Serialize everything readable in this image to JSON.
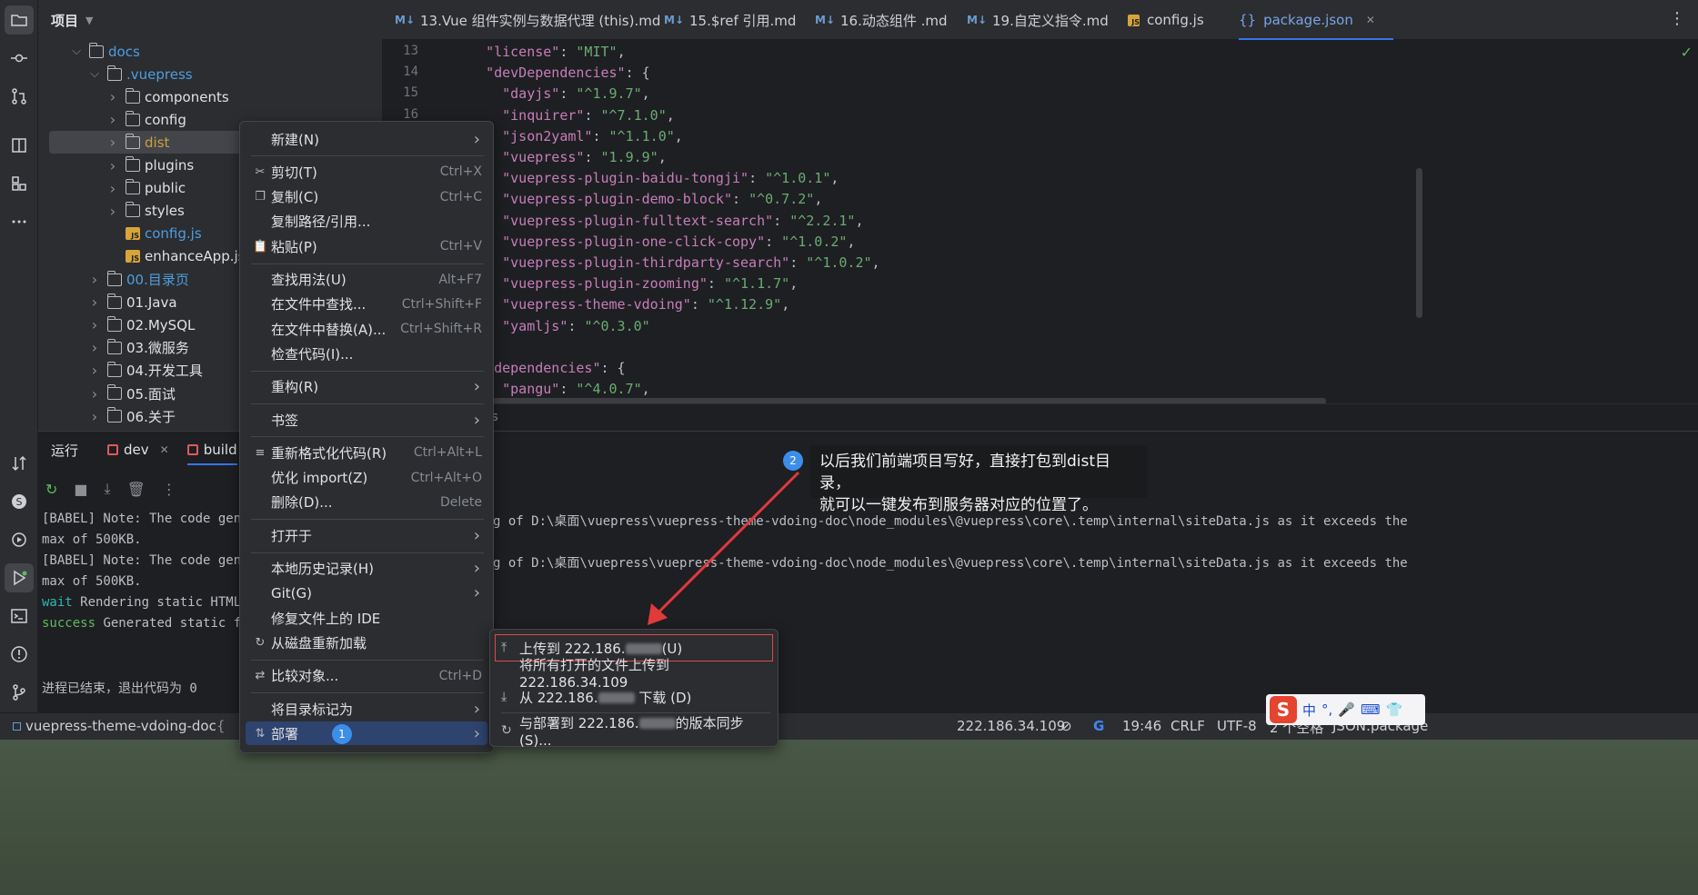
{
  "project": {
    "title": "项目",
    "tree": [
      {
        "label": "docs",
        "type": "folder",
        "depth": 1,
        "open": true,
        "color": "#4f9dde"
      },
      {
        "label": ".vuepress",
        "type": "folder",
        "depth": 2,
        "open": true,
        "color": "#4f9dde"
      },
      {
        "label": "components",
        "type": "folder",
        "depth": 3,
        "open": false,
        "color": "#dfe1e5"
      },
      {
        "label": "config",
        "type": "folder",
        "depth": 3,
        "open": false,
        "color": "#dfe1e5"
      },
      {
        "label": "dist",
        "type": "folder",
        "depth": 3,
        "open": false,
        "color": "#c9a13a",
        "selected": true
      },
      {
        "label": "plugins",
        "type": "folder",
        "depth": 3,
        "open": false,
        "color": "#dfe1e5"
      },
      {
        "label": "public",
        "type": "folder",
        "depth": 3,
        "open": false,
        "color": "#dfe1e5"
      },
      {
        "label": "styles",
        "type": "folder",
        "depth": 3,
        "open": false,
        "color": "#dfe1e5"
      },
      {
        "label": "config.js",
        "type": "js",
        "depth": 3,
        "color": "#4f9dde"
      },
      {
        "label": "enhanceApp.js",
        "type": "js",
        "depth": 3,
        "color": "#dfe1e5"
      },
      {
        "label": "00.目录页",
        "type": "folder",
        "depth": 2,
        "open": false,
        "color": "#4f9dde"
      },
      {
        "label": "01.Java",
        "type": "folder",
        "depth": 2,
        "open": false,
        "color": "#dfe1e5"
      },
      {
        "label": "02.MySQL",
        "type": "folder",
        "depth": 2,
        "open": false,
        "color": "#dfe1e5"
      },
      {
        "label": "03.微服务",
        "type": "folder",
        "depth": 2,
        "open": false,
        "color": "#dfe1e5"
      },
      {
        "label": "04.开发工具",
        "type": "folder",
        "depth": 2,
        "open": false,
        "color": "#dfe1e5"
      },
      {
        "label": "05.面试",
        "type": "folder",
        "depth": 2,
        "open": false,
        "color": "#dfe1e5"
      },
      {
        "label": "06.关于",
        "type": "folder",
        "depth": 2,
        "open": false,
        "color": "#dfe1e5"
      }
    ]
  },
  "tabs": [
    {
      "label": "13.Vue 组件实例与数据代理 (this).md",
      "kind": "md"
    },
    {
      "label": "15.$ref 引用.md",
      "kind": "md"
    },
    {
      "label": "16.动态组件 .md",
      "kind": "md"
    },
    {
      "label": "19.自定义指令.md",
      "kind": "md"
    },
    {
      "label": "config.js",
      "kind": "js"
    },
    {
      "label": "package.json",
      "kind": "json",
      "active": true
    }
  ],
  "editor": {
    "lines": [
      {
        "num": "13",
        "text": "  \"license\": \"MIT\","
      },
      {
        "num": "14",
        "text": "  \"devDependencies\": {"
      },
      {
        "num": "15",
        "text": "    \"dayjs\": \"^1.9.7\","
      },
      {
        "num": "16",
        "text": "    \"inquirer\": \"^7.1.0\","
      },
      {
        "num": "",
        "text": "    \"json2yaml\": \"^1.1.0\","
      },
      {
        "num": "",
        "text": "    \"vuepress\": \"1.9.9\","
      },
      {
        "num": "",
        "text": "    \"vuepress-plugin-baidu-tongji\": \"^1.0.1\","
      },
      {
        "num": "",
        "text": "    \"vuepress-plugin-demo-block\": \"^0.7.2\","
      },
      {
        "num": "",
        "text": "    \"vuepress-plugin-fulltext-search\": \"^2.2.1\","
      },
      {
        "num": "",
        "text": "    \"vuepress-plugin-one-click-copy\": \"^1.0.2\","
      },
      {
        "num": "",
        "text": "    \"vuepress-plugin-thirdparty-search\": \"^1.0.2\","
      },
      {
        "num": "",
        "text": "    \"vuepress-plugin-zooming\": \"^1.1.7\","
      },
      {
        "num": "",
        "text": "    \"vuepress-theme-vdoing\": \"^1.12.9\","
      },
      {
        "num": "",
        "text": "    \"yamljs\": \"^0.3.0\""
      },
      {
        "num": "",
        "text": ""
      },
      {
        "num": "",
        "text": "  \"dependencies\": {"
      },
      {
        "num": "",
        "text": "    \"pangu\": \"^4.0.7\","
      }
    ],
    "breadcrumb": "s"
  },
  "run": {
    "title": "运行",
    "tabs": [
      "dev",
      "build"
    ],
    "console": [
      {
        "text": "[BABEL] Note: The code generator has deoptimised the styling of D:\\桌面\\vuepress\\vuepress-theme-vdoing-doc\\node_modules\\@vuepress\\core\\.temp\\internal\\siteData.js as it exceeds the",
        "cls": ""
      },
      {
        "text": "max of 500KB.",
        "cls": ""
      },
      {
        "text": "[BABEL] Note: The code generator has deoptimised the styling of D:\\桌面\\vuepress\\vuepress-theme-vdoing-doc\\node_modules\\@vuepress\\core\\.temp\\internal\\siteData.js as it exceeds the",
        "cls": ""
      },
      {
        "text": "max of 500KB.",
        "cls": ""
      },
      {
        "prefix": "wait",
        "text": " Rendering static HTML...",
        "cls": "cyan"
      },
      {
        "prefix": "success",
        "text": " Generated static files in docs/.vuepress/dist.",
        "cls": "green"
      },
      {
        "text": "",
        "cls": ""
      },
      {
        "text": "进程已结束，退出代码为 0",
        "cls": ""
      }
    ],
    "console_left": [
      "[BABEL] Note: The code gen",
      "max of 500KB.",
      "[BABEL] Note: The code gen",
      "max of 500KB.",
      " Rendering static HTML",
      " Generated static f",
      "",
      "进程已结束，退出代码为 0"
    ],
    "console_right": [
      "g of D:\\桌面\\vuepress\\vuepress-theme-vdoing-doc\\node_modules\\@vuepress\\core\\.temp\\internal\\siteData.js as it exceeds the",
      "",
      "g of D:\\桌面\\vuepress\\vuepress-theme-vdoing-doc\\node_modules\\@vuepress\\core\\.temp\\internal\\siteData.js as it exceeds the"
    ]
  },
  "menu": {
    "items": [
      {
        "label": "新建(N)",
        "submenu": true
      },
      {
        "sep": true
      },
      {
        "label": "剪切(T)",
        "shortcut": "Ctrl+X",
        "icon": "✂"
      },
      {
        "label": "复制(C)",
        "shortcut": "Ctrl+C",
        "icon": "❐"
      },
      {
        "label": "复制路径/引用..."
      },
      {
        "label": "粘贴(P)",
        "shortcut": "Ctrl+V",
        "icon": "📋"
      },
      {
        "sep": true
      },
      {
        "label": "查找用法(U)",
        "shortcut": "Alt+F7"
      },
      {
        "label": "在文件中查找...",
        "shortcut": "Ctrl+Shift+F"
      },
      {
        "label": "在文件中替换(A)...",
        "shortcut": "Ctrl+Shift+R"
      },
      {
        "label": "检查代码(I)..."
      },
      {
        "sep": true
      },
      {
        "label": "重构(R)",
        "submenu": true
      },
      {
        "sep": true
      },
      {
        "label": "书签",
        "submenu": true
      },
      {
        "sep": true
      },
      {
        "label": "重新格式化代码(R)",
        "shortcut": "Ctrl+Alt+L",
        "icon": "≡"
      },
      {
        "label": "优化 import(Z)",
        "shortcut": "Ctrl+Alt+O"
      },
      {
        "label": "删除(D)...",
        "shortcut": "Delete"
      },
      {
        "sep": true
      },
      {
        "label": "打开于",
        "submenu": true
      },
      {
        "sep": true
      },
      {
        "label": "本地历史记录(H)",
        "submenu": true
      },
      {
        "label": "Git(G)",
        "submenu": true
      },
      {
        "label": "修复文件上的 IDE"
      },
      {
        "label": "从磁盘重新加载",
        "icon": "↻"
      },
      {
        "sep": true
      },
      {
        "label": "比较对象...",
        "shortcut": "Ctrl+D",
        "icon": "⇄"
      },
      {
        "sep": true
      },
      {
        "label": "将目录标记为",
        "submenu": true
      },
      {
        "label": "部署",
        "submenu": true,
        "icon": "⇅",
        "highlighted": true
      }
    ]
  },
  "submenu": {
    "items": [
      {
        "prefix": "上传到 222.186.",
        "suffix": "(U)",
        "icon": "⤒",
        "boxed": true
      },
      {
        "prefix": "将所有打开的文件上传到 222.186.34.109",
        "suffix": ""
      },
      {
        "prefix": "从 222.186.",
        "suffix": " 下载 (D)",
        "icon": "⤓"
      },
      {
        "prefix": "与部署到 222.186.",
        "suffix": "的版本同步(S)...",
        "icon": "↻"
      }
    ]
  },
  "annotations": {
    "badge1": "1",
    "badge2": "2",
    "callout_line1": "以后我们前端项目写好，直接打包到dist目录，",
    "callout_line2": "就可以一键发布到服务器对应的位置了。"
  },
  "statusbar": {
    "project": "vuepress-theme-vdoing-doc",
    "server": "222.186.34.109",
    "time": "19:46",
    "eol": "CRLF",
    "encoding": "UTF-8",
    "indent": "2 个空格",
    "filetype": "JSON:package"
  },
  "ime": {
    "lang": "中",
    "punct": "°,"
  }
}
